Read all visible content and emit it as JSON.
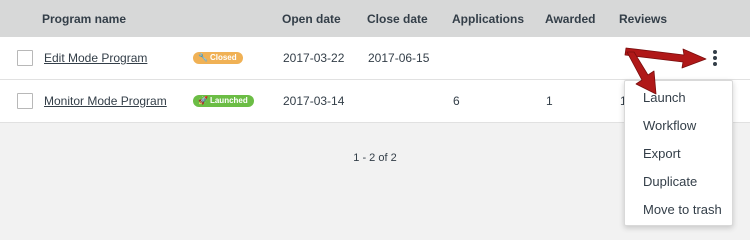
{
  "table": {
    "columns": [
      "Program name",
      "Open date",
      "Close date",
      "Applications",
      "Awarded",
      "Reviews"
    ],
    "rows": [
      {
        "name": "Edit Mode Program",
        "status": "Closed",
        "status_icon": "wrench-icon",
        "open_date": "2017-03-22",
        "close_date": "2017-06-15",
        "applications": "",
        "awarded": "",
        "reviews": ""
      },
      {
        "name": "Monitor Mode Program",
        "status": "Launched",
        "status_icon": "rocket-icon",
        "open_date": "2017-03-14",
        "close_date": "",
        "applications": "6",
        "awarded": "1",
        "reviews": "1"
      }
    ]
  },
  "pagination": {
    "text": "1 - 2 of 2"
  },
  "menu": {
    "items": [
      "Launch",
      "Workflow",
      "Export",
      "Duplicate",
      "Move to trash"
    ]
  },
  "colors": {
    "header_bg": "#d7d8d8",
    "closed_badge": "#f0b155",
    "launched_badge": "#6bbd45",
    "annotation_arrow": "#b01818"
  },
  "icons": {
    "row_menu": "kebab-menu-icon",
    "annotation": "red-arrow-annotation"
  }
}
